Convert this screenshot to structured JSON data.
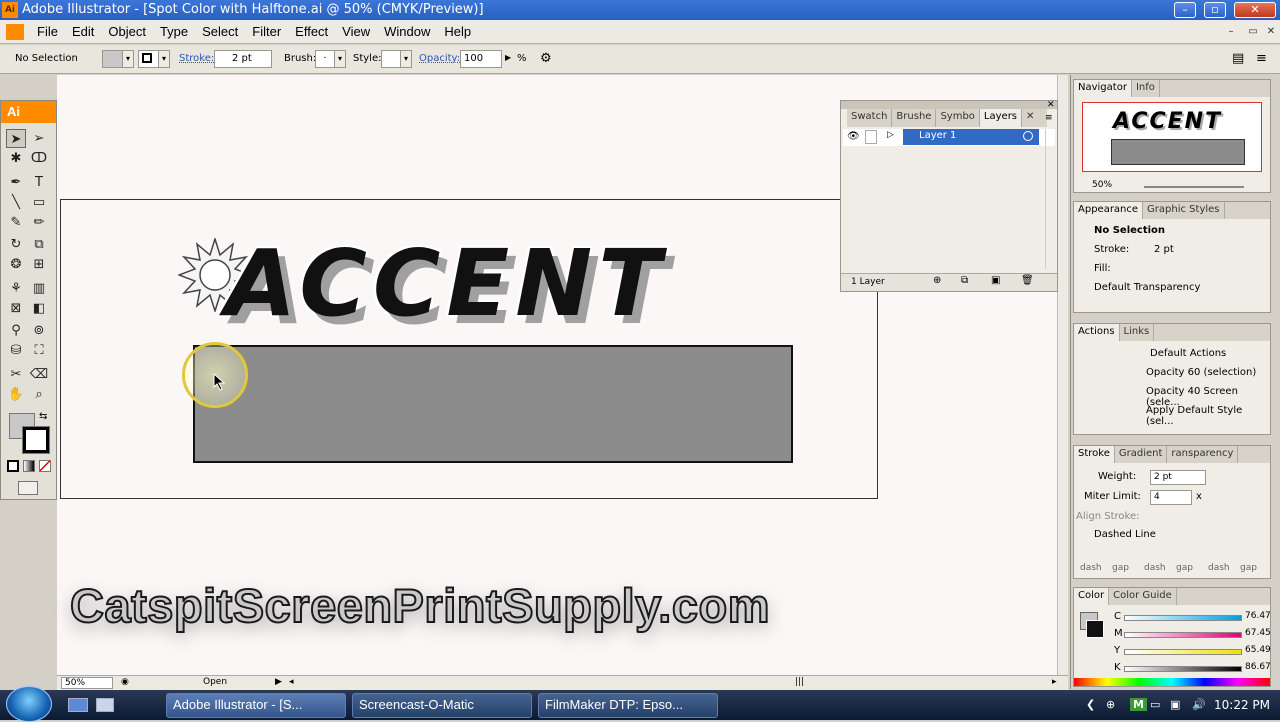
{
  "window": {
    "title": "Adobe Illustrator - [Spot Color with Halftone.ai @ 50% (CMYK/Preview)]"
  },
  "menu": [
    "File",
    "Edit",
    "Object",
    "Type",
    "Select",
    "Filter",
    "Effect",
    "View",
    "Window",
    "Help"
  ],
  "control_bar": {
    "selection": "No Selection",
    "stroke_label": "Stroke:",
    "stroke_value": "2 pt",
    "brush_label": "Brush:",
    "brush_value": "·",
    "style_label": "Style:",
    "opacity_label": "Opacity:",
    "opacity_value": "100",
    "opacity_unit": "%"
  },
  "tools_panel": {
    "logo": "Ai"
  },
  "artwork": {
    "headline": "ACCENT",
    "watermark": "CatspitScreenPrintSupply.com",
    "colors": {
      "text": "#111111",
      "shadow": "#a0a0a0",
      "box_fill": "#8c8c8c"
    }
  },
  "status_bar": {
    "zoom": "50%",
    "status": "Open"
  },
  "layers_panel": {
    "tabs": [
      "Swatch",
      "Brushe",
      "Symbo",
      "Layers"
    ],
    "layer_name": "Layer 1",
    "count": "1 Layer"
  },
  "navigator_panel": {
    "tabs": [
      "Navigator",
      "Info"
    ],
    "thumb_text": "ACCENT",
    "zoom": "50%"
  },
  "appearance_panel": {
    "tabs": [
      "Appearance",
      "Graphic Styles"
    ],
    "heading": "No Selection",
    "stroke_label": "Stroke:",
    "stroke_value": "2 pt",
    "fill_label": "Fill:",
    "default": "Default Transparency"
  },
  "actions_panel": {
    "tabs": [
      "Actions",
      "Links"
    ],
    "set_name": "Default Actions",
    "items": [
      "Opacity 60 (selection)",
      "Opacity 40 Screen (sele...",
      "Apply Default Style (sel..."
    ]
  },
  "stroke_panel": {
    "tabs": [
      "Stroke",
      "Gradient",
      "ransparency"
    ],
    "weight_label": "Weight:",
    "weight_value": "2 pt",
    "miter_label": "Miter Limit:",
    "miter_value": "4",
    "miter_unit": "x",
    "align_label": "Align Stroke:",
    "dashed_label": "Dashed Line",
    "dash_labels": [
      "dash",
      "gap",
      "dash",
      "gap",
      "dash",
      "gap"
    ]
  },
  "color_panel": {
    "tabs": [
      "Color",
      "Color Guide"
    ],
    "channels": [
      {
        "name": "C",
        "value": "76.47",
        "unit": "%"
      },
      {
        "name": "M",
        "value": "67.45",
        "unit": "%"
      },
      {
        "name": "Y",
        "value": "65.49",
        "unit": "%"
      },
      {
        "name": "K",
        "value": "86.67",
        "unit": "%"
      }
    ]
  },
  "taskbar": {
    "items": [
      "Adobe Illustrator - [S...",
      "Screencast-O-Matic",
      "FilmMaker DTP: Epso..."
    ],
    "clock": "10:22 PM"
  }
}
